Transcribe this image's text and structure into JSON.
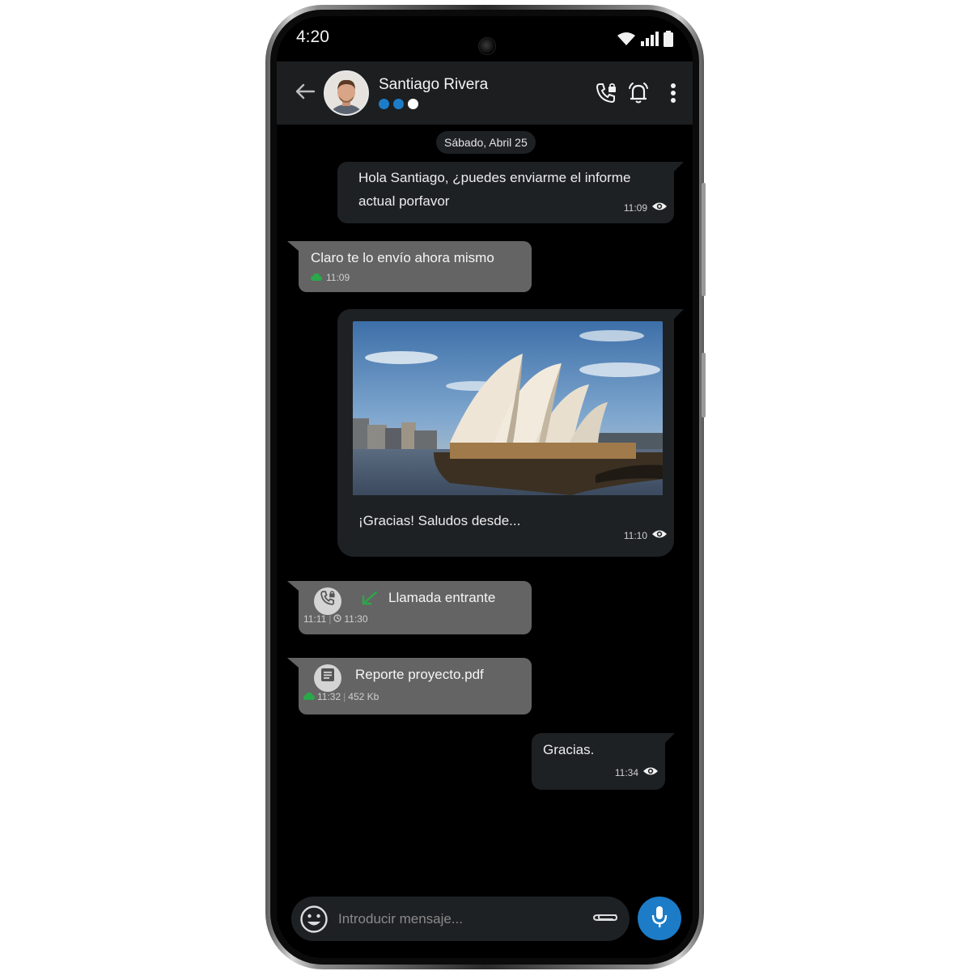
{
  "status_bar": {
    "time": "4:20"
  },
  "header": {
    "contact_name": "Santiago Rivera",
    "presence_dot_colors": [
      "#1c7cc8",
      "#1c7cc8",
      "#ffffff"
    ],
    "icons": [
      "back-arrow-icon",
      "secure-call-icon",
      "alarm-bell-icon",
      "more-vertical-icon"
    ]
  },
  "date_label": "Sábado, Abril 25",
  "messages": [
    {
      "direction": "out",
      "text_line1": "Hola Santiago, ¿puedes enviarme el informe",
      "text_line2": "actual porfavor",
      "time": "11:09",
      "status_icon": "eye-icon"
    },
    {
      "direction": "in",
      "text": "Claro te lo envío ahora mismo",
      "time": "11:09",
      "status_icon": "secure-cloud-icon"
    },
    {
      "direction": "out",
      "type": "image",
      "image_subject": "sydney-opera-house-photo",
      "caption": "¡Gracias! Saludos desde...",
      "time": "11:10",
      "status_icon": "eye-icon"
    },
    {
      "direction": "in",
      "type": "call",
      "text": "Llamada entrante",
      "time": "11:11",
      "duration": "11:30",
      "icons": [
        "secure-call-icon",
        "incoming-arrow-icon",
        "timer-icon"
      ]
    },
    {
      "direction": "in",
      "type": "file",
      "file_name": "Reporte proyecto.pdf",
      "time": "11:32",
      "size": "452 Kb",
      "icons": [
        "document-icon",
        "secure-cloud-icon"
      ]
    },
    {
      "direction": "out",
      "text": "Gracias.",
      "time": "11:34",
      "status_icon": "eye-icon"
    }
  ],
  "composer": {
    "placeholder": "Introducir mensaje...",
    "icons": [
      "emoji-icon",
      "paperclip-icon",
      "microphone-icon"
    ]
  },
  "colors": {
    "accent": "#1c7cc8",
    "incoming_bubble": "#646464",
    "outgoing_bubble": "#1e2124",
    "header": "#1c1e20",
    "secure_green": "#2aa84a"
  }
}
